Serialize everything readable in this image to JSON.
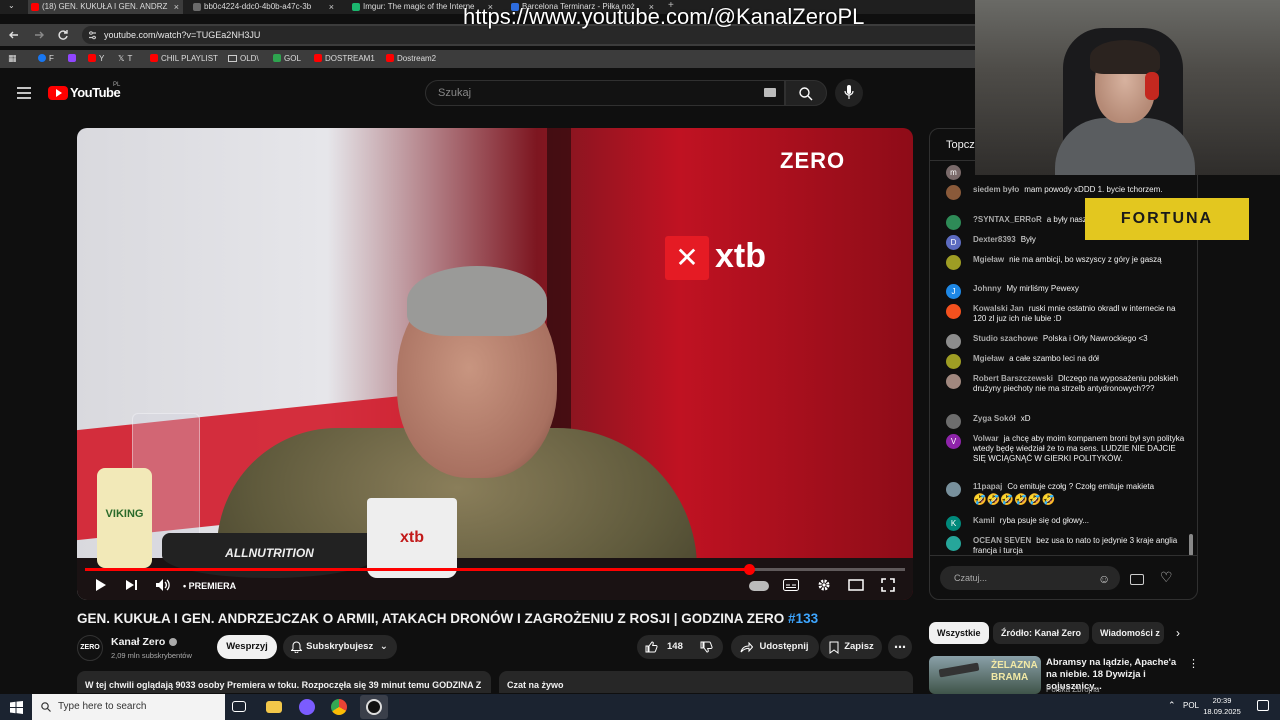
{
  "browser": {
    "tabs": [
      {
        "label": "(18) GEN. KUKUŁA I GEN. ANDRZ",
        "active": true,
        "favicon_color": "#ff0000"
      },
      {
        "label": "bb0c4224-ddc0-4b0b-a47c-3b",
        "active": false,
        "favicon_color": "#3c3c3c"
      },
      {
        "label": "Imgur: The magic of the Interne",
        "active": false,
        "favicon_color": "#1bb76e"
      },
      {
        "label": "Barcelona Terminarz - Piłka noż",
        "active": false,
        "favicon_color": "#2d6cdf"
      }
    ],
    "url": "youtube.com/watch?v=TUGEa2NH3JU",
    "bookmarks": [
      {
        "label": "F",
        "color": "#1877f2"
      },
      {
        "label": "",
        "color": "#9146ff"
      },
      {
        "label": "Y",
        "color": "#ff0000"
      },
      {
        "label": "T",
        "color": "#ffffff"
      },
      {
        "label": "CHIL PLAYLIST",
        "color": "#ff0000"
      },
      {
        "label": "OLD\\",
        "color": "#bbbbbb"
      },
      {
        "label": "GOL",
        "color": "#2ea44f"
      },
      {
        "label": "DOSTREAM1",
        "color": "#ff0000"
      },
      {
        "label": "Dostream2",
        "color": "#ff0000"
      }
    ]
  },
  "overlay": {
    "channel_url": "https://www.youtube.com/@KanalZeroPL",
    "sponsor": "FORTUNA"
  },
  "youtube": {
    "logo_text": "YouTube",
    "region": "PL",
    "search_placeholder": "Szukaj"
  },
  "video": {
    "progress_fraction": 0.81,
    "premiere_label": "• PREMIERA",
    "brand_logo": "ZERO",
    "sponsor_logo": "xtb",
    "mug_text": "xtb",
    "bowl_text": "ALLNUTRITION",
    "jar_text": "VIKING",
    "title": "GEN. KUKUŁA I GEN. ANDRZEJCZAK O ARMII, ATAKACH DRONÓW I ZAGROŻENIU Z ROSJI | GODZINA ZERO",
    "episode_tag": "#133"
  },
  "channel": {
    "avatar_text": "ZERO",
    "name": "Kanał Zero",
    "subscribers": "2,09 mln subskrybentów",
    "support_label": "Wesprzyj",
    "subscribed_label": "Subskrybujesz"
  },
  "actions": {
    "likes": "148",
    "share_label": "Udostępnij",
    "save_label": "Zapisz"
  },
  "description": {
    "text": "W tej chwili oglądają 9033 osoby  Premiera w toku. Rozpoczęła się 39 minut temu  GODZINA Z",
    "live_chat_label": "Czat na żywo"
  },
  "chat": {
    "header": "Topcz",
    "input_placeholder": "Czatuj...",
    "messages": [
      {
        "author": "",
        "text": "",
        "avatar": "m",
        "color": "#7a6a6a"
      },
      {
        "author": "siedem było",
        "text": "mam powody xDDD 1. bycie tchorzem.",
        "avatar": "",
        "color": "#8a5a3a"
      },
      {
        "author": "?SYNTAX_ERRoR",
        "text": "a były nasz",
        "avatar": "",
        "color": "#2e8b57"
      },
      {
        "author": "Dexter8393",
        "text": "Były",
        "avatar": "D",
        "color": "#5c6bc0"
      },
      {
        "author": "Mgieław",
        "text": "nie ma ambicji, bo wszyscy z góry je gaszą",
        "avatar": "",
        "color": "#9e9d24"
      },
      {
        "author": "Johnny",
        "text": "My mirliśmy Pewexy",
        "avatar": "J",
        "color": "#1e88e5"
      },
      {
        "author": "Kowalski Jan",
        "text": "ruski mnie ostatnio okradl w internecie na 120 zl juz ich nie lubie :D",
        "avatar": "",
        "color": "#f4511e"
      },
      {
        "author": "Studio szachowe",
        "text": "Polska i Orły Nawrockiego <3",
        "avatar": "",
        "color": "#8d8d8d"
      },
      {
        "author": "Mgieław",
        "text": "a całe szambo leci na dół",
        "avatar": "",
        "color": "#9e9d24"
      },
      {
        "author": "Robert Barszczewski",
        "text": "Dlczego na wyposażeniu polskieh drużyny piechoty nie ma strzelb antydronowych???",
        "avatar": "",
        "color": "#a1887f"
      },
      {
        "author": "Zyga Sokół",
        "text": "xD",
        "avatar": "",
        "color": "#6d6d6d"
      },
      {
        "author": "Volwar",
        "text": "ja chcę aby moim kompanem broni był syn polityka wtedy będę wiedział że to ma sens. LUDZIE NIE DAJCIE SIĘ WCIĄGNĄĆ W GIERKI POLITYKÓW.",
        "avatar": "V",
        "color": "#8e24aa"
      },
      {
        "author": "11papaj",
        "text": "Co emituje czołg ? Czołg emituje makieta",
        "avatar": "",
        "color": "#78909c"
      },
      {
        "author": "Kamil",
        "text": "ryba psuje się od głowy...",
        "avatar": "K",
        "color": "#00897b"
      },
      {
        "author": "OCEAN SEVEN",
        "text": "bez usa to nato to jedynie 3 kraje anglia francja i turcja",
        "avatar": "",
        "color": "#26a69a"
      }
    ],
    "emoji_row": "🤣🤣🤣🤣🤣🤣"
  },
  "recommendations": {
    "chips": [
      "Wszystkie",
      "Źródło: Kanał Zero",
      "Wiadomości z"
    ],
    "first": {
      "thumb_text": "ŻELAZNA BRAMA",
      "title": "Abramsy na lądzie, Apache'a na niebie. 18 Dywizja i sojusznicy...",
      "channel": "Polska Zbrojna"
    }
  },
  "taskbar": {
    "search_placeholder": "Type here to search",
    "language": "POL",
    "time": "20:39",
    "date": "18.09.2025"
  }
}
